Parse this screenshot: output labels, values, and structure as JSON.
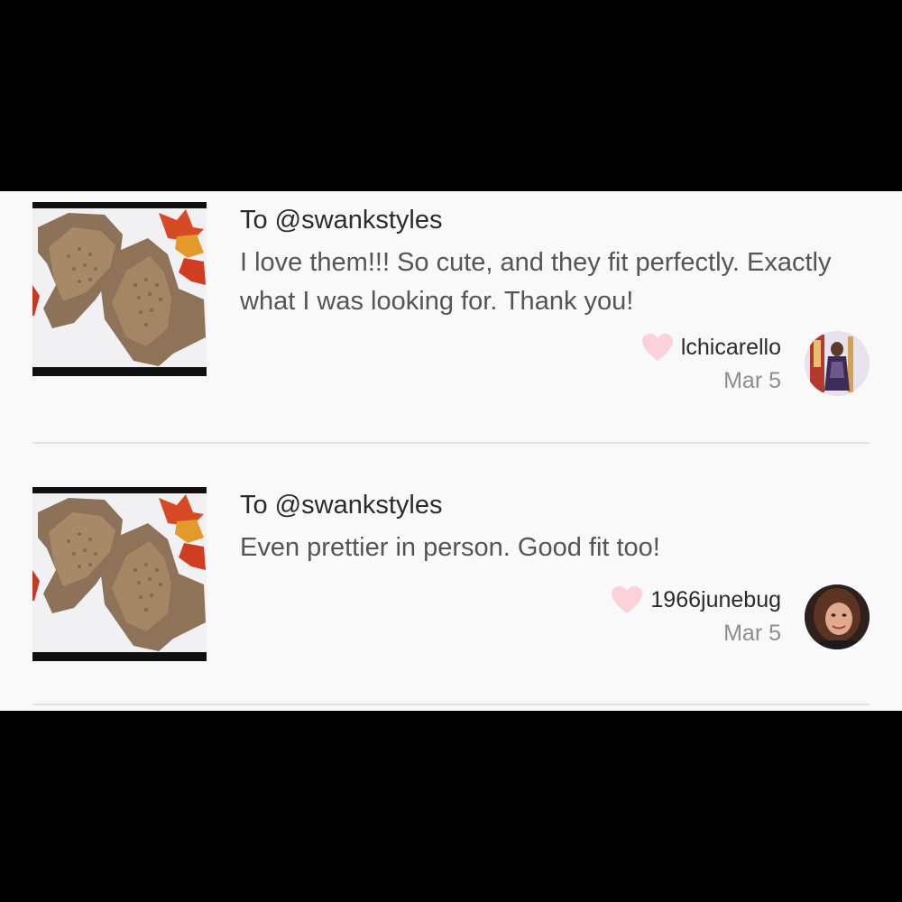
{
  "reviews": [
    {
      "to": "To @swankstyles",
      "text": "I love them!!! So cute, and they fit perfectly. Exactly what I was looking for. Thank you!",
      "username": "lchicarello",
      "date": "Mar 5",
      "heart_color": "#fbd2da"
    },
    {
      "to": "To @swankstyles",
      "text": "Even prettier in person. Good fit too!",
      "username": "1966junebug",
      "date": "Mar 5",
      "heart_color": "#fbd2da"
    }
  ]
}
